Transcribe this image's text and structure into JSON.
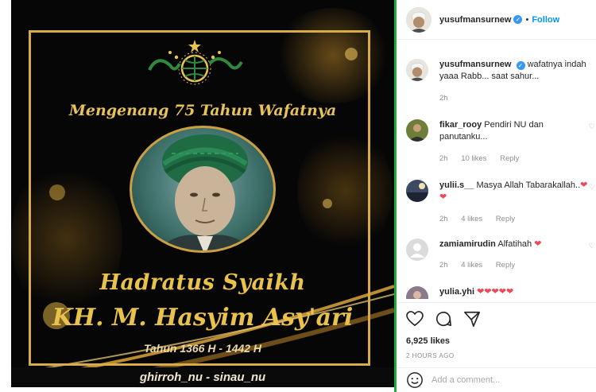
{
  "poster": {
    "subtitle": "Mengenang 75 Tahun Wafatnya",
    "name_line1": "Hadratus Syaikh",
    "name_line2": "KH. M. Hasyim Asy'ari",
    "years": "Tahun 1366 H - 1442 H",
    "credit": "ghirroh_nu - sinau_nu",
    "gold_color": "#e9c24c"
  },
  "header": {
    "username": "yusufmansurnew",
    "dot": "•",
    "follow_label": "Follow"
  },
  "caption": {
    "username": "yusufmansurnew",
    "text": "wafatnya indah yaaa Rabb... saat sahur...",
    "time": "2h"
  },
  "comments": [
    {
      "username": "fikar_rooy",
      "text": "Pendiri NU dan panutanku...",
      "time": "2h",
      "likes": "10 likes",
      "reply": "Reply"
    },
    {
      "username": "yulii.s__",
      "text": "Masya Allah Tabarakallah..",
      "hearts": "❤❤",
      "time": "2h",
      "likes": "4 likes",
      "reply": "Reply"
    },
    {
      "username": "zamiamirudin",
      "text": "Alfatihah",
      "hearts": "❤",
      "time": "2h",
      "likes": "4 likes",
      "reply": "Reply"
    },
    {
      "username": "yulia.yhi",
      "text": "",
      "hearts": "❤❤❤❤❤",
      "time": "",
      "likes": "",
      "reply": ""
    }
  ],
  "stats": {
    "likes": "6,925 likes",
    "posted": "2 HOURS AGO"
  },
  "add_comment": {
    "placeholder": "Add a comment..."
  },
  "icons": {
    "like": "heart-icon",
    "comment": "comment-icon",
    "share": "share-icon",
    "emoji": "emoji-icon",
    "verified": "verified-badge-icon"
  },
  "colors": {
    "follow": "#0095f6",
    "heart": "#ed4956",
    "verified": "#3897f0",
    "divider": "#1faa3a"
  }
}
